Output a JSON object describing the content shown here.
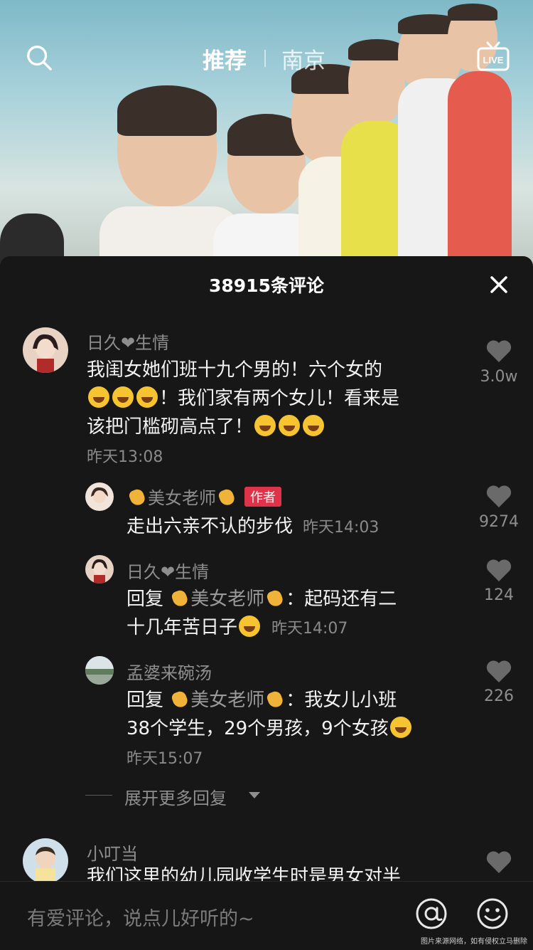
{
  "header": {
    "tab_recommend": "推荐",
    "tab_city": "南京",
    "search_icon": "search-icon",
    "live_icon": "live-icon"
  },
  "comments_panel": {
    "title": "38915条评论",
    "close_icon": "close-icon"
  },
  "comments": [
    {
      "user": "日久❤生情",
      "text_lines": [
        "我闺女她们班十九个男的！六个女的",
        "！我们家有两个女儿！看来是",
        "该把门槛砌高点了！"
      ],
      "time": "昨天13:08",
      "likes": "3.0w"
    },
    {
      "user_pre": "",
      "user": "美女老师",
      "badge": "作者",
      "text": "走出六亲不认的步伐",
      "time": "昨天14:03",
      "likes": "9274"
    },
    {
      "user": "日久❤生情",
      "reply_word": "回复",
      "mention": "美女老师",
      "text_line1": "：起码还有二",
      "text_line2": "十几年苦日子",
      "time": "昨天14:07",
      "likes": "124"
    },
    {
      "user": "孟婆来碗汤",
      "reply_word": "回复",
      "mention": "美女老师",
      "text_line1": "：我女儿小班",
      "text_line2": "38个学生，29个男孩，9个女孩",
      "time": "昨天15:07",
      "likes": "226"
    },
    {
      "user": "小叮当",
      "text": "我们这里的幼儿园收学生时是男女对半"
    }
  ],
  "expand_more": "展开更多回复",
  "bottom_bar": {
    "placeholder": "有爱评论，说点儿好听的~",
    "at_icon": "at-icon",
    "emoji_icon": "smile-icon"
  },
  "watermark": "图片来源网络，如有侵权立马删除",
  "colors": {
    "panel_bg": "#171717",
    "author_badge": "#e0334a",
    "muted_text": "#8e8e8e"
  }
}
